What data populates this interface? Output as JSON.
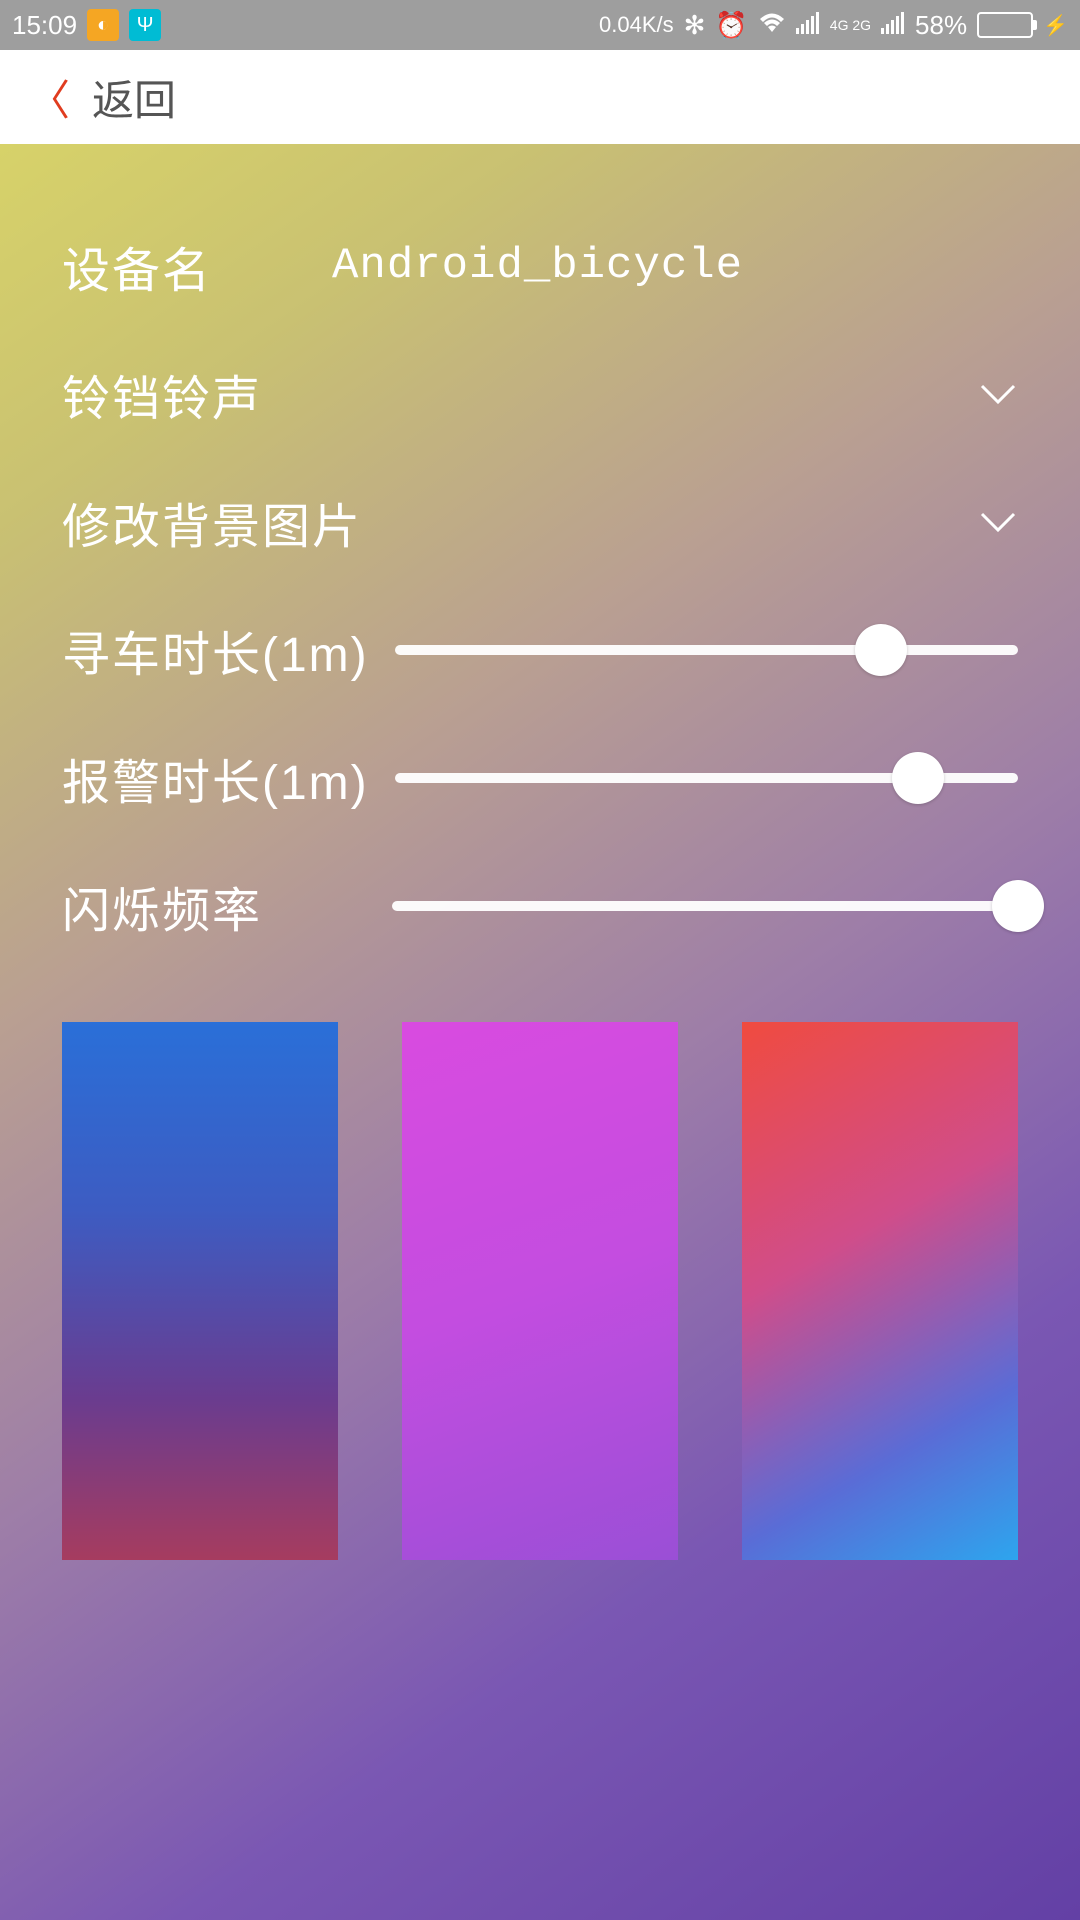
{
  "status": {
    "time": "15:09",
    "speed": "0.04K/s",
    "network": "4G 2G",
    "battery_pct": "58%"
  },
  "header": {
    "back_label": "返回"
  },
  "settings": {
    "device_label": "设备名",
    "device_value": "Android_bicycle",
    "ringtone_label": "铃铛铃声",
    "background_label": "修改背景图片",
    "find_duration_label": "寻车时长(1m)",
    "alarm_duration_label": "报警时长(1m)",
    "blink_freq_label": "闪烁频率",
    "sliders": {
      "find_duration_pct": 78,
      "alarm_duration_pct": 84,
      "blink_freq_pct": 100
    }
  }
}
